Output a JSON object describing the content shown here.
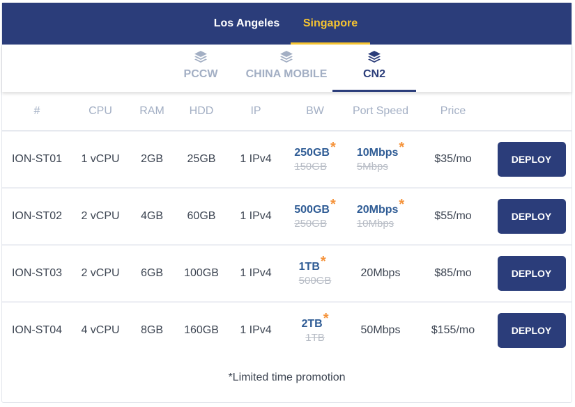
{
  "locations": [
    {
      "label": "Los Angeles",
      "active": false
    },
    {
      "label": "Singapore",
      "active": true
    }
  ],
  "networks": [
    {
      "label": "PCCW",
      "icon": "layers-icon",
      "active": false
    },
    {
      "label": "CHINA MOBILE",
      "icon": "layers-icon",
      "active": false
    },
    {
      "label": "CN2",
      "icon": "layers-icon",
      "active": true
    }
  ],
  "table": {
    "headers": [
      "#",
      "CPU",
      "RAM",
      "HDD",
      "IP",
      "BW",
      "Port Speed",
      "Price",
      ""
    ],
    "rows": [
      {
        "id": "ION-ST01",
        "cpu": "1 vCPU",
        "ram": "2GB",
        "hdd": "25GB",
        "ip": "1 IPv4",
        "bw_new": "250GB",
        "bw_old": "150GB",
        "port_new": "10Mbps",
        "port_old": "5Mbps",
        "port": "",
        "price": "$35/mo",
        "action": "DEPLOY"
      },
      {
        "id": "ION-ST02",
        "cpu": "2 vCPU",
        "ram": "4GB",
        "hdd": "60GB",
        "ip": "1 IPv4",
        "bw_new": "500GB",
        "bw_old": "250GB",
        "port_new": "20Mbps",
        "port_old": "10Mbps",
        "port": "",
        "price": "$55/mo",
        "action": "DEPLOY"
      },
      {
        "id": "ION-ST03",
        "cpu": "2 vCPU",
        "ram": "6GB",
        "hdd": "100GB",
        "ip": "1 IPv4",
        "bw_new": "1TB",
        "bw_old": "500GB",
        "port_new": "",
        "port_old": "",
        "port": "20Mbps",
        "price": "$85/mo",
        "action": "DEPLOY"
      },
      {
        "id": "ION-ST04",
        "cpu": "4 vCPU",
        "ram": "8GB",
        "hdd": "160GB",
        "ip": "1 IPv4",
        "bw_new": "2TB",
        "bw_old": "1TB",
        "port_new": "",
        "port_old": "",
        "port": "50Mbps",
        "price": "$155/mo",
        "action": "DEPLOY"
      }
    ]
  },
  "promo_marker": "*",
  "footnote": "*Limited time promotion",
  "colors": {
    "brand": "#2b3d7a",
    "accent": "#f6c431",
    "promo_star": "#f5933b"
  }
}
